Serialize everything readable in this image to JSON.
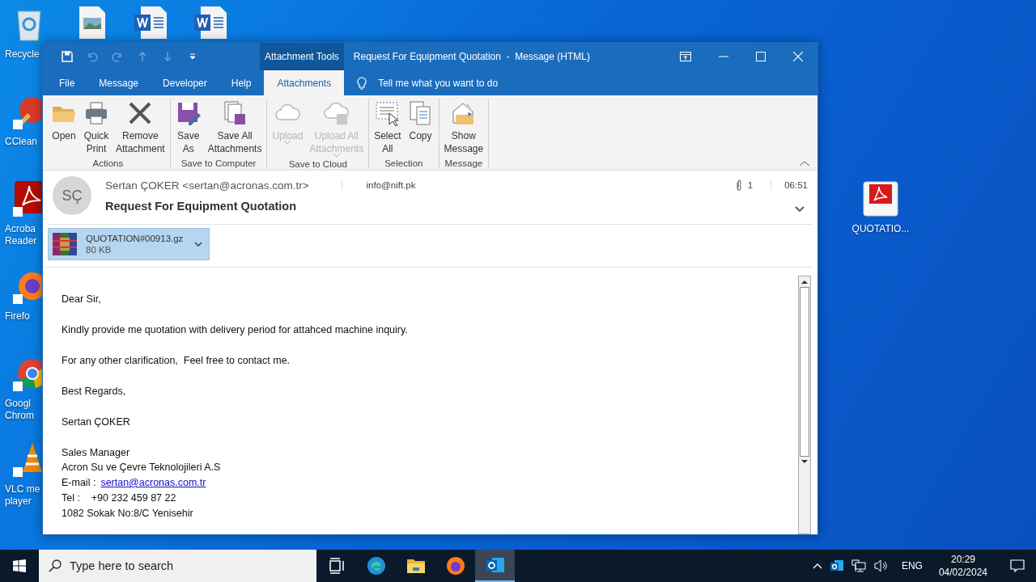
{
  "desktop": {
    "left_icons": [
      {
        "kind": "recycle",
        "lines": [
          "Recycle"
        ]
      },
      {
        "kind": "ccleaner",
        "lines": [
          "CClean"
        ]
      },
      {
        "kind": "acrobat",
        "lines": [
          "Acroba",
          "Reader"
        ]
      },
      {
        "kind": "firefox",
        "lines": [
          "Firefo"
        ]
      },
      {
        "kind": "chrome",
        "lines": [
          "Googl",
          "Chrom"
        ]
      },
      {
        "kind": "vlc",
        "lines": [
          "VLC me",
          "player"
        ]
      }
    ],
    "right_icons": [
      {
        "kind": "pdf",
        "lines": [
          "QUOTATIO..."
        ]
      }
    ]
  },
  "window": {
    "context_tab": "Attachment Tools",
    "title": "Request For Equipment Quotation  -  Message (HTML)",
    "quick_access": [
      {
        "kind": "save",
        "disabled": false
      },
      {
        "kind": "undo",
        "disabled": true
      },
      {
        "kind": "redo",
        "disabled": true
      },
      {
        "kind": "up",
        "disabled": true
      },
      {
        "kind": "down",
        "disabled": true
      },
      {
        "kind": "customize",
        "disabled": false
      }
    ],
    "tabs": [
      {
        "label": "File",
        "selected": false
      },
      {
        "label": "Message",
        "selected": false
      },
      {
        "label": "Developer",
        "selected": false
      },
      {
        "label": "Help",
        "selected": false
      },
      {
        "label": "Attachments",
        "selected": true
      }
    ],
    "tell_me": "Tell me what you want to do",
    "ribbon_groups": [
      {
        "label": "Actions",
        "buttons": [
          {
            "kind": "open",
            "lines": [
              "Open"
            ],
            "disabled": false,
            "dropdown": false
          },
          {
            "kind": "print",
            "lines": [
              "Quick",
              "Print"
            ],
            "disabled": false,
            "dropdown": false
          },
          {
            "kind": "remove",
            "lines": [
              "Remove",
              "Attachment"
            ],
            "disabled": false,
            "dropdown": false
          }
        ]
      },
      {
        "label": "Save to Computer",
        "buttons": [
          {
            "kind": "save_as",
            "lines": [
              "Save",
              "As"
            ],
            "disabled": false,
            "dropdown": false
          },
          {
            "kind": "save_all",
            "lines": [
              "Save All",
              "Attachments"
            ],
            "disabled": false,
            "dropdown": false
          }
        ]
      },
      {
        "label": "Save to Cloud",
        "buttons": [
          {
            "kind": "upload",
            "lines": [
              "Upload"
            ],
            "disabled": true,
            "dropdown": true
          },
          {
            "kind": "upload_all",
            "lines": [
              "Upload All",
              "Attachments"
            ],
            "disabled": true,
            "dropdown": true
          }
        ]
      },
      {
        "label": "Selection",
        "buttons": [
          {
            "kind": "select_all",
            "lines": [
              "Select",
              "All"
            ],
            "disabled": false,
            "dropdown": false
          },
          {
            "kind": "copy",
            "lines": [
              "Copy"
            ],
            "disabled": false,
            "dropdown": false
          }
        ]
      },
      {
        "label": "Message",
        "buttons": [
          {
            "kind": "show_message",
            "lines": [
              "Show",
              "Message"
            ],
            "disabled": false,
            "dropdown": false
          }
        ]
      }
    ]
  },
  "message": {
    "avatar": "SÇ",
    "sender": "Sertan ÇOKER <sertan@acronas.com.tr>",
    "to": "info@nift.pk",
    "attachment_count": "1",
    "time": "06:51",
    "subject": "Request For Equipment Quotation",
    "attachments": [
      {
        "name": "QUOTATION#00913.gz",
        "size": "80 KB",
        "selected": true
      }
    ],
    "body": [
      {
        "kind": "para",
        "text": "Dear Sir,"
      },
      {
        "kind": "para",
        "text": "Kindly provide me quotation with delivery period for attahced machine inquiry."
      },
      {
        "kind": "para",
        "text": "For any other clarification,  Feel free to contact me."
      },
      {
        "kind": "para",
        "text": "Best Regards,"
      },
      {
        "kind": "para",
        "text": "Sertan ÇOKER"
      },
      {
        "kind": "para",
        "text": "Sales Manager"
      },
      {
        "kind": "line",
        "text": "Acron Su ve Çevre Teknolojileri A.S"
      },
      {
        "kind": "link_line",
        "text": "E-mail :",
        "link": "sertan@acronas.com.tr"
      },
      {
        "kind": "line",
        "text": "Tel :    +90 232 459 87 22"
      },
      {
        "kind": "line",
        "text": "1082 Sokak No:8/C Yenisehir"
      }
    ]
  },
  "taskbar": {
    "search_placeholder": "Type here to search",
    "apps": [
      {
        "kind": "task_view",
        "active": false
      },
      {
        "kind": "edge",
        "active": false
      },
      {
        "kind": "explorer",
        "active": false
      },
      {
        "kind": "firefox",
        "active": false
      },
      {
        "kind": "outlook",
        "active": true
      }
    ],
    "language": "ENG",
    "time": "20:29",
    "date": "04/02/2024"
  }
}
